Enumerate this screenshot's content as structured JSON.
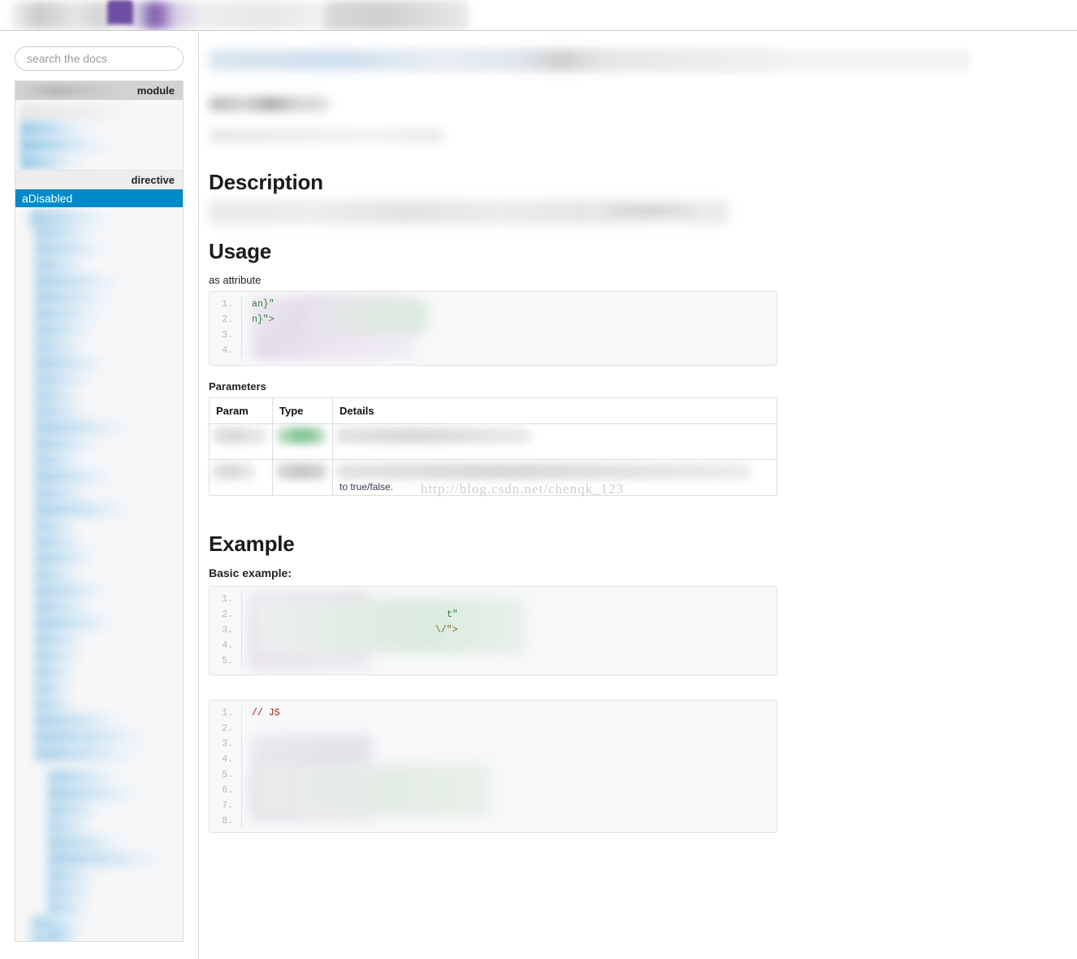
{
  "browser": {
    "tabs": [
      {
        "label": "",
        "state": "blurred-active"
      },
      {
        "label": "",
        "state": "blurred-inactive"
      }
    ],
    "accent_color": "#6f4fa3"
  },
  "sidebar": {
    "search": {
      "placeholder": "search the docs",
      "value": ""
    },
    "groups": [
      {
        "header_label": "module",
        "header_blurred_title": "",
        "items_blurred_count": 6
      },
      {
        "header_label": "directive",
        "selected_item": "aDisabled",
        "items_blurred_count": 52
      }
    ],
    "selected_color": "#0089c9"
  },
  "main": {
    "page_title_blurred": "",
    "subtitle_blurred": "",
    "sections": {
      "description": {
        "heading": "Description",
        "body_blurred": ""
      },
      "usage": {
        "heading": "Usage",
        "attribute_label": "as attribute",
        "code": {
          "language": "html",
          "lines": [
            {
              "no": "1.",
              "visible_tail": "an}\""
            },
            {
              "no": "2.",
              "visible_tail": "n}\">"
            },
            {
              "no": "3.",
              "visible_tail": ""
            },
            {
              "no": "4.",
              "visible_tail": ""
            }
          ]
        },
        "parameters": {
          "heading": "Parameters",
          "columns": [
            "Param",
            "Type",
            "Details"
          ],
          "rows": [
            {
              "param": "",
              "type": "",
              "details": "",
              "type_highlight": "green"
            },
            {
              "param": "",
              "type": "",
              "details": "",
              "details_visible_fragment": "to true/false.",
              "type_highlight": "grey"
            }
          ]
        }
      },
      "example": {
        "heading": "Example",
        "basic_label": "Basic example:",
        "code_html": {
          "language": "html",
          "lines": [
            {
              "no": "1.",
              "visible_tail": ""
            },
            {
              "no": "2.",
              "visible_tail": "t\""
            },
            {
              "no": "3.",
              "visible_tail": "\\/\">"
            },
            {
              "no": "4.",
              "visible_tail": ""
            },
            {
              "no": "5.",
              "visible_tail": ""
            }
          ]
        },
        "code_js": {
          "language": "javascript",
          "lines": [
            {
              "no": "1.",
              "visible_tail": "// JS"
            },
            {
              "no": "2.",
              "visible_tail": ""
            },
            {
              "no": "3.",
              "visible_tail": ""
            },
            {
              "no": "4.",
              "visible_tail": ""
            },
            {
              "no": "5.",
              "visible_tail": ""
            },
            {
              "no": "6.",
              "visible_tail": ""
            },
            {
              "no": "7.",
              "visible_tail": ""
            },
            {
              "no": "8.",
              "visible_tail": ""
            }
          ]
        }
      }
    }
  },
  "watermark": {
    "text": "http://blog.csdn.net/chenqk_123"
  }
}
